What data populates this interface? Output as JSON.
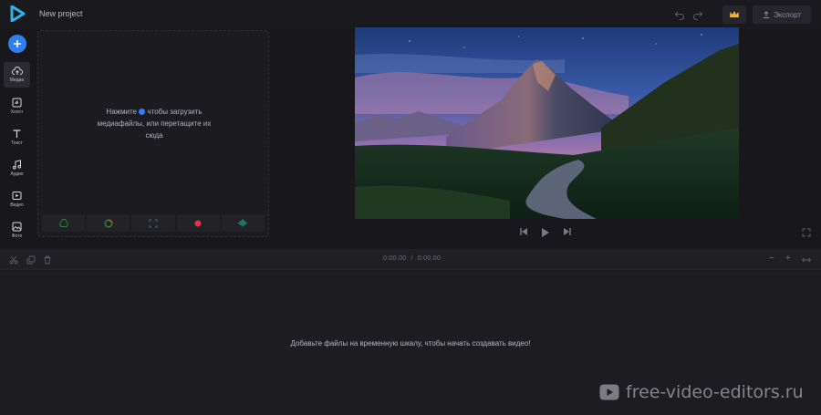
{
  "header": {
    "project_title": "New project",
    "export_label": "Экспорт"
  },
  "sidebar": {
    "items": [
      {
        "label": "Медиа",
        "icon": "cloud-upload-icon",
        "active": true
      },
      {
        "label": "Холст",
        "icon": "canvas-icon",
        "active": false
      },
      {
        "label": "Текст",
        "icon": "text-icon",
        "active": false
      },
      {
        "label": "Аудио",
        "icon": "music-note-icon",
        "active": false
      },
      {
        "label": "Видео",
        "icon": "video-icon",
        "active": false
      },
      {
        "label": "Фото",
        "icon": "photo-icon",
        "active": false
      }
    ]
  },
  "media": {
    "drop_text_part1": "Нажмите",
    "drop_text_part2": "чтобы загрузить медиафайлы, или перетащите их сюда",
    "sources": [
      "google-drive-icon",
      "google-photos-icon",
      "screen-record-icon",
      "webcam-record-icon",
      "voice-record-icon"
    ]
  },
  "timeline": {
    "current_time": "0:00.00",
    "separator": "/",
    "total_time": "0:00.00",
    "empty_message": "Добавьте файлы на временную шкалу, чтобы начать создавать видео!"
  },
  "watermark": {
    "text": "free-video-editors.ru"
  },
  "colors": {
    "accent": "#2f7ff0",
    "crown": "#f2b33d",
    "record": "#e0334a",
    "voice": "#22b8a0"
  }
}
